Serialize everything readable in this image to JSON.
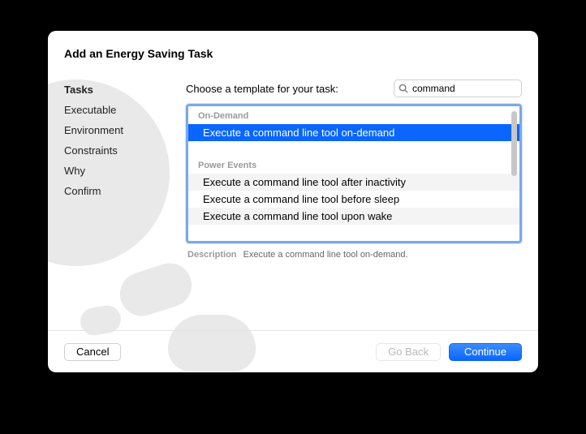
{
  "title": "Add an Energy Saving Task",
  "sidebar": {
    "items": [
      {
        "label": "Tasks",
        "active": true
      },
      {
        "label": "Executable",
        "active": false
      },
      {
        "label": "Environment",
        "active": false
      },
      {
        "label": "Constraints",
        "active": false
      },
      {
        "label": "Why",
        "active": false
      },
      {
        "label": "Confirm",
        "active": false
      }
    ]
  },
  "main": {
    "prompt": "Choose a template for your task:",
    "search": {
      "value": "command",
      "placeholder": "Search"
    },
    "sections": [
      {
        "header": "On-Demand",
        "items": [
          {
            "label": "Execute a command line tool on-demand",
            "selected": true
          }
        ]
      },
      {
        "header": "Power Events",
        "items": [
          {
            "label": "Execute a command line tool after inactivity",
            "selected": false
          },
          {
            "label": "Execute a command line tool before sleep",
            "selected": false
          },
          {
            "label": "Execute a command line tool upon wake",
            "selected": false
          }
        ]
      }
    ],
    "description_label": "Description",
    "description_text": "Execute a command line tool on-demand."
  },
  "footer": {
    "cancel": "Cancel",
    "go_back": "Go Back",
    "continue": "Continue"
  }
}
